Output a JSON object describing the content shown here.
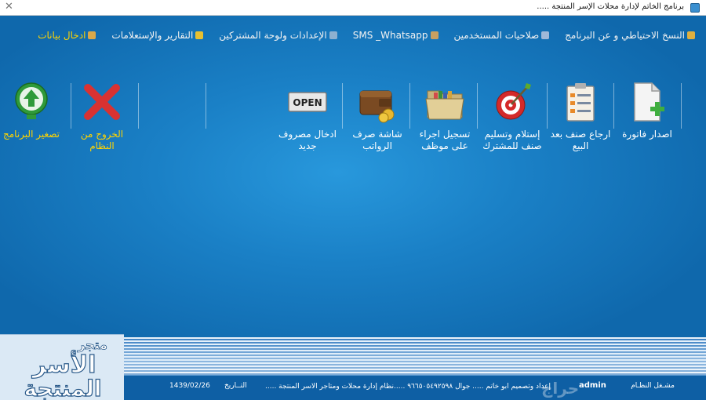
{
  "window": {
    "title": "برنامج الخاتم لإدارة محلات الإسر المنتجة ....."
  },
  "menu": [
    {
      "label": "ادخال بيانات",
      "icon": "bar-chart-icon",
      "color": "#d9a84a",
      "active": true
    },
    {
      "label": "التقارير والإستعلامات",
      "icon": "report-icon",
      "color": "#e8c030",
      "active": false
    },
    {
      "label": "الإعدادات ولوحة المشتركين",
      "icon": "settings-icon",
      "color": "#8db0d0",
      "active": false
    },
    {
      "label": "SMS _Whatsapp",
      "icon": "message-icon",
      "color": "#c8a060",
      "active": false
    },
    {
      "label": "صلاحيات المستخدمين",
      "icon": "users-icon",
      "color": "#9fb8d8",
      "active": false
    },
    {
      "label": "النسخ الاحتياطي و عن البرنامج",
      "icon": "home-icon",
      "color": "#e0b040",
      "active": false
    }
  ],
  "tools": [
    {
      "label": "اصدار فاتورة",
      "icon": "new-invoice-icon"
    },
    {
      "label": "ارجاع صنف بعد البيع",
      "icon": "checklist-icon"
    },
    {
      "label": "إستلام وتسليم صنف للمشترك",
      "icon": "target-icon"
    },
    {
      "label": "تسجيل اجراء على موظف",
      "icon": "folder-icon"
    },
    {
      "label": "شاشة صرف الرواتب",
      "icon": "wallet-icon"
    },
    {
      "label": "ادخال مصروف جديد",
      "icon": "open-sign-icon",
      "icon_text": "OPEN"
    },
    {
      "label": "الخروج من النظام",
      "icon": "exit-x-icon"
    },
    {
      "label": "تصغير البرنامج",
      "icon": "minimize-arrow-icon"
    }
  ],
  "logo": {
    "line1": "متجر",
    "line2": "الأسر",
    "line3": "المنتجة"
  },
  "status": {
    "system_label": "مشـغل النظـام",
    "user": "admin",
    "watermark": "حراج",
    "contact": "إعداد وتصميم ابو خاتم ..... جوال ٩٦٦٥٠٥٤٩٢٥٩٨ .....نظام إدارة محلات ومتاجر الاسر المنتجة .....",
    "date_label": "التــاريخ",
    "date": "1439/02/26"
  },
  "colors": {
    "desktop": "#1a80c6",
    "accent": "#ffd400",
    "status_bg": "#0e5fa4"
  }
}
